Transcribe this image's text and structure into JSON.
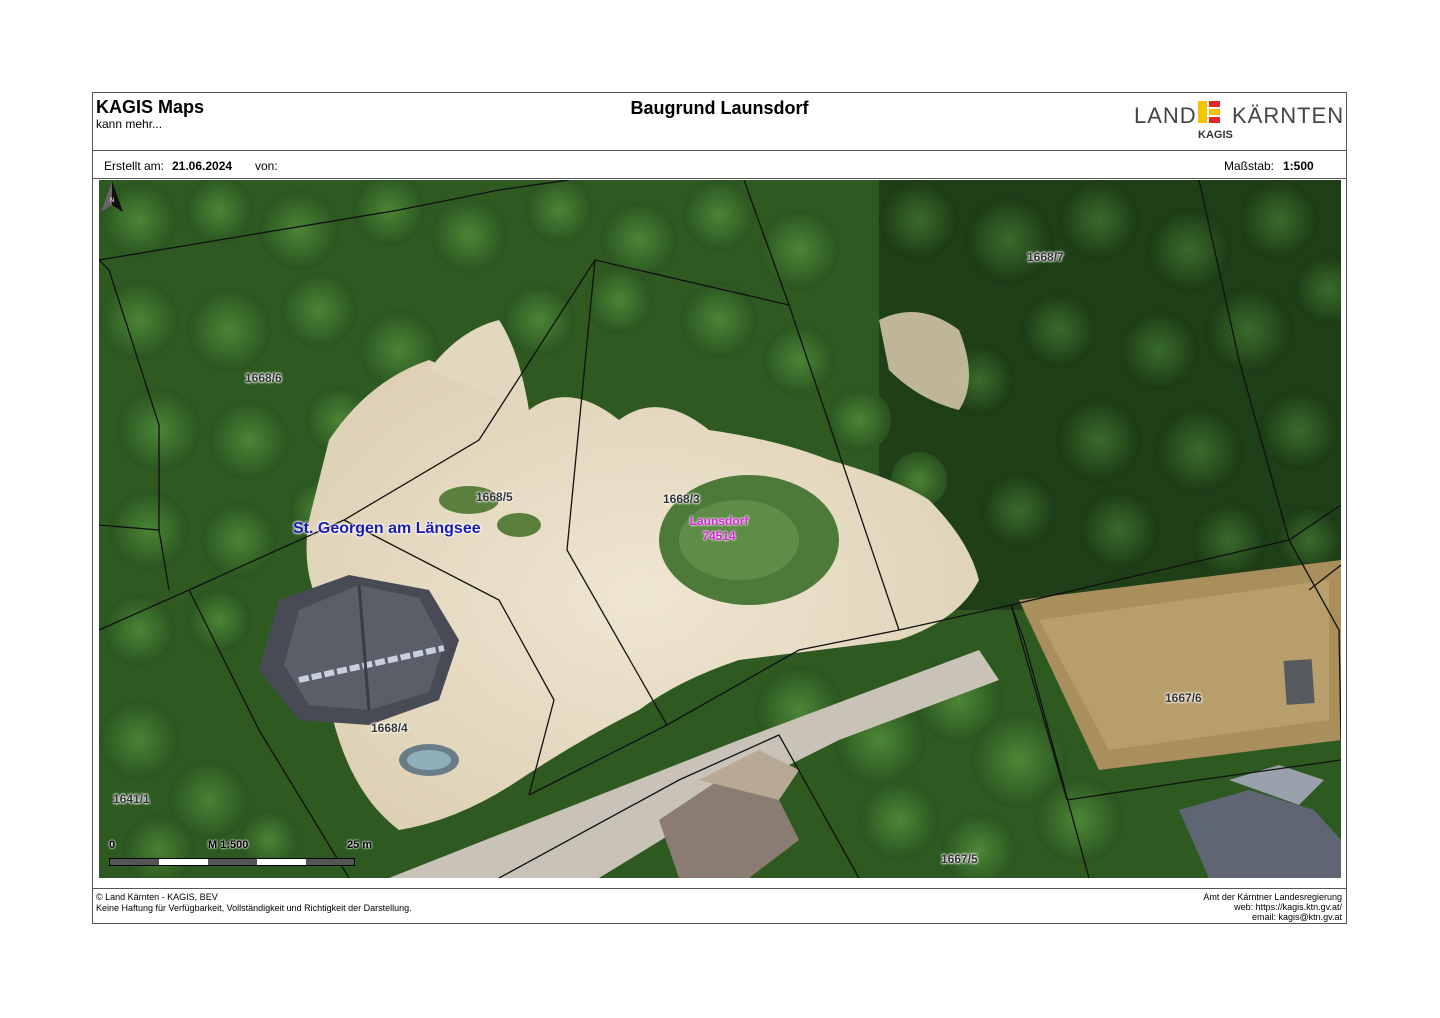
{
  "header": {
    "app_title": "KAGIS Maps",
    "app_subtitle": "kann mehr...",
    "map_title": "Baugrund Launsdorf",
    "logo": {
      "left": "LAND",
      "right": "KÄRNTEN",
      "sub": "KAGIS",
      "colors": {
        "yellow": "#f5c400",
        "red": "#e3262a"
      }
    }
  },
  "info": {
    "created_label": "Erstellt am:",
    "created_date": "21.06.2024",
    "by_label": "von:",
    "scale_label": "Maßstab:",
    "scale_value": "1:500"
  },
  "map": {
    "parcels": [
      "1668/7",
      "1668/6",
      "1668/5",
      "1668/3",
      "1668/4",
      "1641/1",
      "1667/6",
      "1667/5"
    ],
    "place_name": "St. Georgen am Längsee",
    "locality_name": "Launsdorf",
    "locality_code": "74514",
    "scalebar": {
      "start": "0",
      "middle": "M 1:500",
      "end": "25 m"
    },
    "north_arrow": "N",
    "colors": {
      "parcel_lines": "#111111",
      "place": "#1a1ab0",
      "locality": "#e020e0"
    }
  },
  "footer": {
    "copyright": "© Land Kärnten - KAGIS, BEV",
    "disclaimer": "Keine Haftung für Verfügbarkeit, Vollständigkeit und Richtigkeit der Darstellung.",
    "office": "Amt der Kärntner Landesregierung",
    "web": "web: https://kagis.ktn.gv.at/",
    "email": "email: kagis@ktn.gv.at"
  }
}
